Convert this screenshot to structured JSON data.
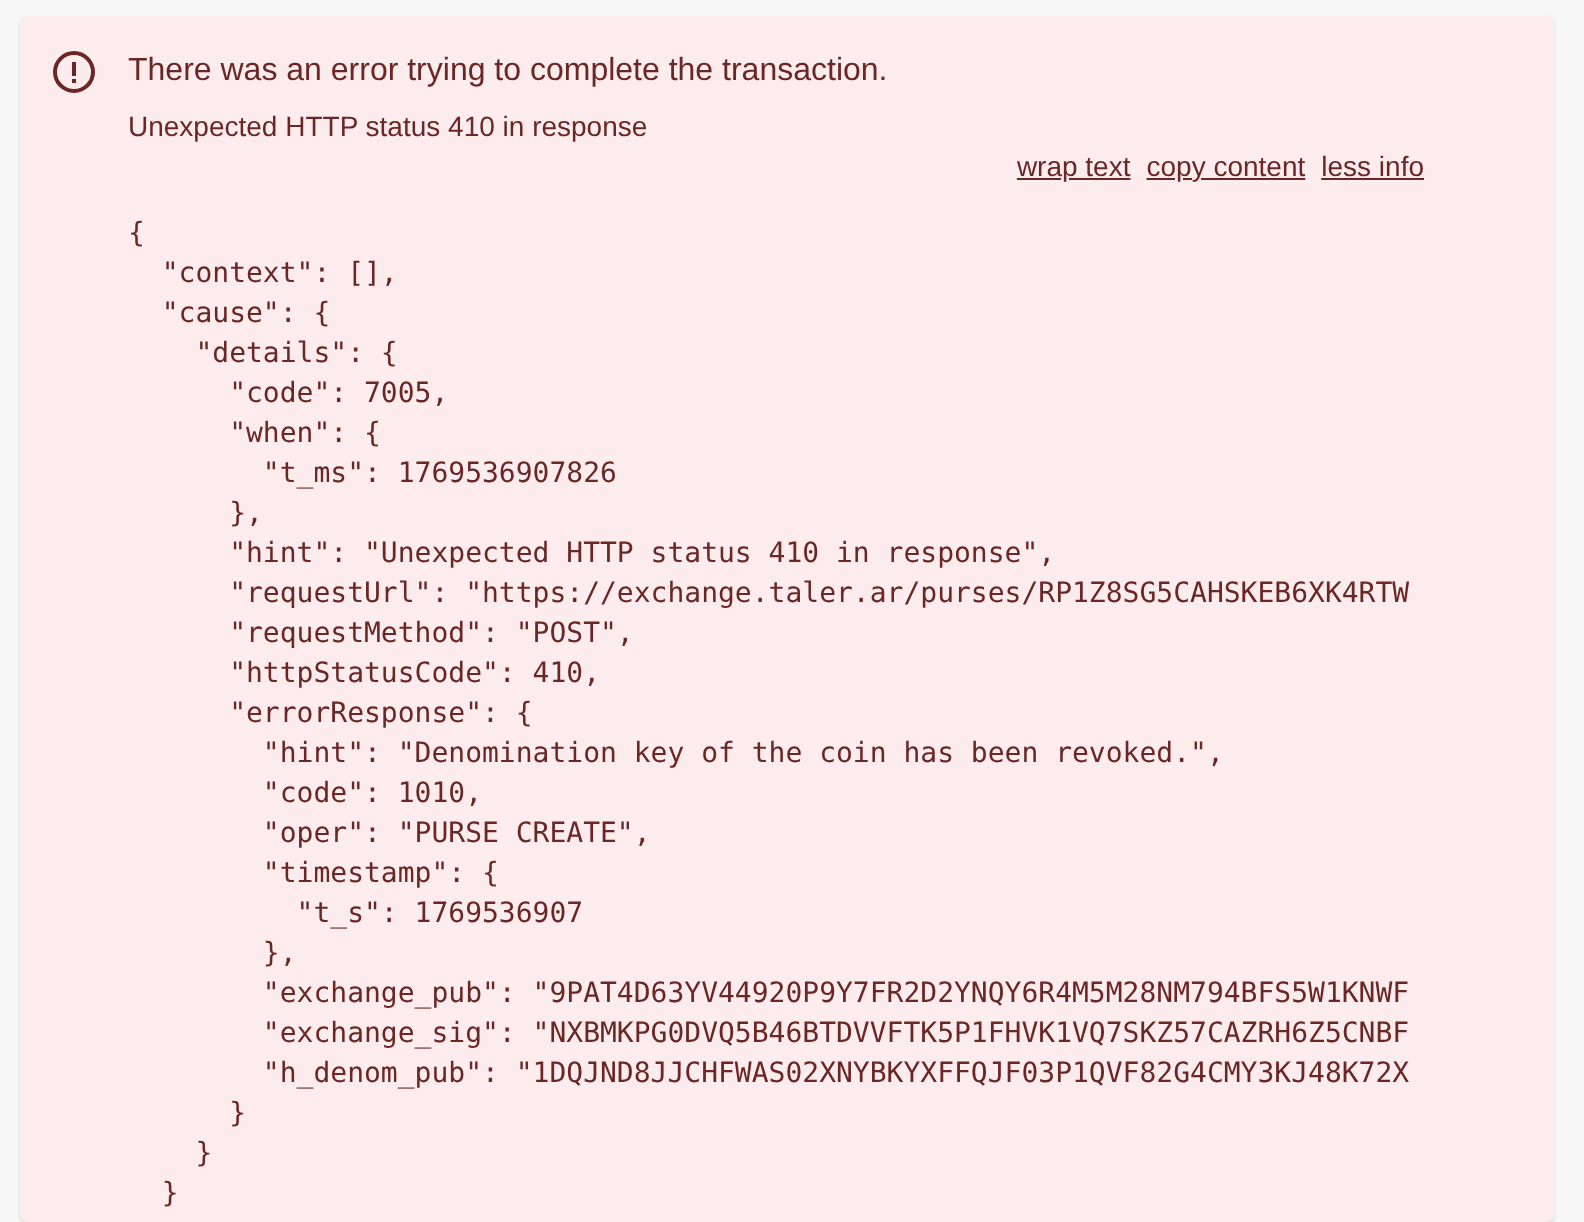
{
  "alert": {
    "title": "There was an error trying to complete the transaction.",
    "message": "Unexpected HTTP status 410 in response",
    "actions": [
      "wrap text",
      "copy content",
      "less info"
    ],
    "code_lines": [
      "{",
      "  \"context\": [],",
      "  \"cause\": {",
      "    \"details\": {",
      "      \"code\": 7005,",
      "      \"when\": {",
      "        \"t_ms\": 1769536907826",
      "      },",
      "      \"hint\": \"Unexpected HTTP status 410 in response\",",
      "      \"requestUrl\": \"https://exchange.taler.ar/purses/RP1Z8SG5CAHSKEB6XK4RTW",
      "      \"requestMethod\": \"POST\",",
      "      \"httpStatusCode\": 410,",
      "      \"errorResponse\": {",
      "        \"hint\": \"Denomination key of the coin has been revoked.\",",
      "        \"code\": 1010,",
      "        \"oper\": \"PURSE CREATE\",",
      "        \"timestamp\": {",
      "          \"t_s\": 1769536907",
      "        },",
      "        \"exchange_pub\": \"9PAT4D63YV44920P9Y7FR2D2YNQY6R4M5M28NM794BFS5W1KNWF",
      "        \"exchange_sig\": \"NXBMKPG0DVQ5B46BTDVVFTK5P1FHVK1VQ7SKZ57CAZRH6Z5CNBF",
      "        \"h_denom_pub\": \"1DQJND8JJCHFWAS02XNYBKYXFFQJF03P1QVF82G4CMY3KJ48K72X",
      "      }",
      "    }",
      "  }"
    ]
  }
}
